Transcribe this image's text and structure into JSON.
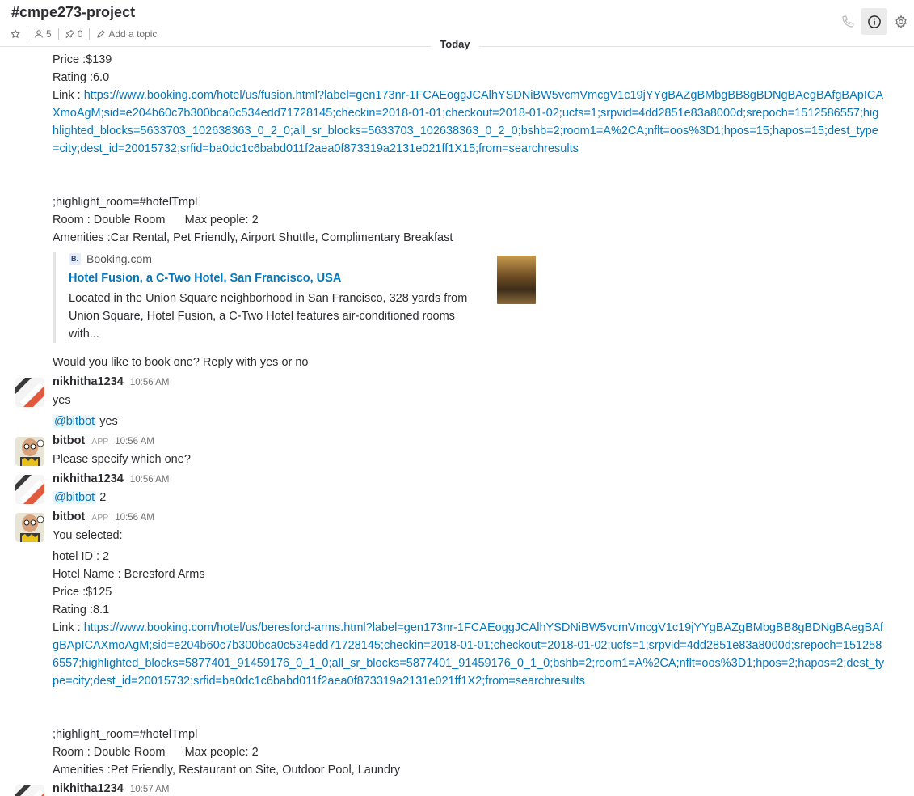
{
  "header": {
    "channel": "#cmpe273-project",
    "members": "5",
    "pins": "0",
    "topic": "Add a topic"
  },
  "today": "Today",
  "hotel1": {
    "price": "Price :$139",
    "rating": "Rating :6.0",
    "link_prefix": "Link : ",
    "link": "https://www.booking.com/hotel/us/fusion.html?label=gen173nr-1FCAEoggJCAlhYSDNiBW5vcmVmcgV1c19jYYgBAZgBMbgBB8gBDNgBAegBAfgBApICAXmoAgM;sid=e204b60c7b300bca0c534edd71728145;checkin=2018-01-01;checkout=2018-01-02;ucfs=1;srpvid=4dd2851e83a8000d;srepoch=1512586557;highlighted_blocks=5633703_102638363_0_2_0;all_sr_blocks=5633703_102638363_0_2_0;bshb=2;room1=A%2CA;nflt=oos%3D1;hpos=15;hapos=15;dest_type=city;dest_id=20015732;srfid=ba0dc1c6babd011f2aea0f873319a2131e021ff1X15;from=searchresults",
    "highlight": ";highlight_room=#hotelTmpl",
    "room": "Room : Double Room      Max people: 2",
    "amenities": "Amenities :Car Rental, Pet Friendly, Airport Shuttle, Complimentary Breakfast"
  },
  "attachment": {
    "service": "Booking.com",
    "logo": "B.",
    "title": "Hotel Fusion, a C-Two Hotel, San Francisco, USA",
    "text": "Located in the Union Square neighborhood in San Francisco, 328 yards from Union Square, Hotel Fusion, a C-Two Hotel features air-conditioned rooms with..."
  },
  "book_prompt": "Would you like to book one? Reply with yes or no",
  "messages": [
    {
      "user": "nikhitha1234",
      "time": "10:56 AM",
      "text": "yes"
    },
    {
      "mention": "@bitbot",
      "text": " yes"
    },
    {
      "user": "bitbot",
      "badge": "APP",
      "time": "10:56 AM",
      "text": "Please specify which one?"
    },
    {
      "user": "nikhitha1234",
      "time": "10:56 AM",
      "mention": "@bitbot",
      "text": " 2"
    },
    {
      "user": "bitbot",
      "badge": "APP",
      "time": "10:56 AM",
      "text": "You selected:"
    },
    {
      "user": "nikhitha1234",
      "time": "10:57 AM"
    }
  ],
  "hotel2": {
    "id": "hotel ID : 2",
    "name": "Hotel Name : Beresford Arms",
    "price": "Price :$125",
    "rating": "Rating :8.1",
    "link_prefix": "Link : ",
    "link": "https://www.booking.com/hotel/us/beresford-arms.html?label=gen173nr-1FCAEoggJCAlhYSDNiBW5vcmVmcgV1c19jYYgBAZgBMbgBB8gBDNgBAegBAfgBApICAXmoAgM;sid=e204b60c7b300bca0c534edd71728145;checkin=2018-01-01;checkout=2018-01-02;ucfs=1;srpvid=4dd2851e83a8000d;srepoch=1512586557;highlighted_blocks=5877401_91459176_0_1_0;all_sr_blocks=5877401_91459176_0_1_0;bshb=2;room1=A%2CA;nflt=oos%3D1;hpos=2;hapos=2;dest_type=city;dest_id=20015732;srfid=ba0dc1c6babd011f2aea0f873319a2131e021ff1X2;from=searchresults",
    "highlight": ";highlight_room=#hotelTmpl",
    "room": "Room : Double Room      Max people: 2",
    "amenities": "Amenities :Pet Friendly, Restaurant on Site, Outdoor Pool, Laundry"
  },
  "colors": {
    "link": "#0576b9",
    "mention_bg": "#e8f5fa",
    "text": "#2c2d30"
  },
  "icons": [
    "star-icon",
    "person-icon",
    "pin-icon",
    "pencil-icon",
    "phone-icon",
    "info-icon",
    "gear-icon"
  ]
}
